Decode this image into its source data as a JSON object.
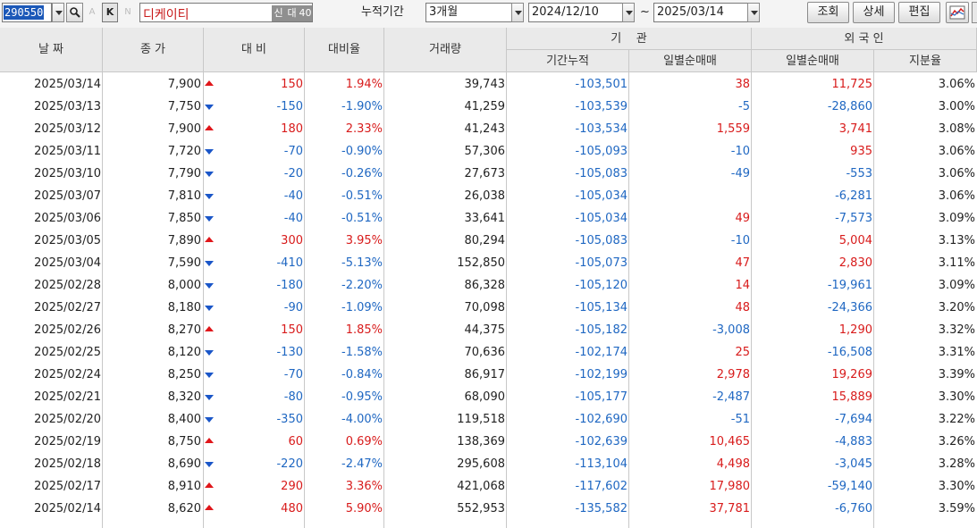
{
  "toolbar": {
    "code": "290550",
    "k_label": "K",
    "a_label": "A",
    "n_label": "N",
    "stock_name": "디케이티",
    "tag_new": "신",
    "tag_large": "대",
    "tag_40": "40",
    "period_label": "누적기간",
    "period_value": "3개월",
    "date_from": "2024/12/10",
    "date_sep": "~",
    "date_to": "2025/03/14",
    "btn_query": "조회",
    "btn_detail": "상세",
    "btn_edit": "편집"
  },
  "headers": {
    "date": "날 짜",
    "close": "종 가",
    "change": "대 비",
    "change_rate": "대비율",
    "volume": "거래량",
    "institution": "기    관",
    "inst_cum": "기간누적",
    "inst_daily": "일별순매매",
    "foreign": "외 국 인",
    "foreign_daily": "일별순매매",
    "foreign_ratio": "지분율"
  },
  "colors": {
    "up": "#d81b1b",
    "down": "#1f67c2",
    "header_bg": "#eaeaea"
  },
  "rows": [
    {
      "date": "2025/03/14",
      "close": "7,900",
      "dir": "up",
      "change": "150",
      "rate": "1.94%",
      "volume": "39,743",
      "inst_cum": "-103,501",
      "inst_daily": "38",
      "foreign_daily": "11,725",
      "foreign_ratio": "3.06%"
    },
    {
      "date": "2025/03/13",
      "close": "7,750",
      "dir": "down",
      "change": "-150",
      "rate": "-1.90%",
      "volume": "41,259",
      "inst_cum": "-103,539",
      "inst_daily": "-5",
      "foreign_daily": "-28,860",
      "foreign_ratio": "3.00%"
    },
    {
      "date": "2025/03/12",
      "close": "7,900",
      "dir": "up",
      "change": "180",
      "rate": "2.33%",
      "volume": "41,243",
      "inst_cum": "-103,534",
      "inst_daily": "1,559",
      "foreign_daily": "3,741",
      "foreign_ratio": "3.08%"
    },
    {
      "date": "2025/03/11",
      "close": "7,720",
      "dir": "down",
      "change": "-70",
      "rate": "-0.90%",
      "volume": "57,306",
      "inst_cum": "-105,093",
      "inst_daily": "-10",
      "foreign_daily": "935",
      "foreign_ratio": "3.06%"
    },
    {
      "date": "2025/03/10",
      "close": "7,790",
      "dir": "down",
      "change": "-20",
      "rate": "-0.26%",
      "volume": "27,673",
      "inst_cum": "-105,083",
      "inst_daily": "-49",
      "foreign_daily": "-553",
      "foreign_ratio": "3.06%"
    },
    {
      "date": "2025/03/07",
      "close": "7,810",
      "dir": "down",
      "change": "-40",
      "rate": "-0.51%",
      "volume": "26,038",
      "inst_cum": "-105,034",
      "inst_daily": "",
      "foreign_daily": "-6,281",
      "foreign_ratio": "3.06%"
    },
    {
      "date": "2025/03/06",
      "close": "7,850",
      "dir": "down",
      "change": "-40",
      "rate": "-0.51%",
      "volume": "33,641",
      "inst_cum": "-105,034",
      "inst_daily": "49",
      "foreign_daily": "-7,573",
      "foreign_ratio": "3.09%"
    },
    {
      "date": "2025/03/05",
      "close": "7,890",
      "dir": "up",
      "change": "300",
      "rate": "3.95%",
      "volume": "80,294",
      "inst_cum": "-105,083",
      "inst_daily": "-10",
      "foreign_daily": "5,004",
      "foreign_ratio": "3.13%"
    },
    {
      "date": "2025/03/04",
      "close": "7,590",
      "dir": "down",
      "change": "-410",
      "rate": "-5.13%",
      "volume": "152,850",
      "inst_cum": "-105,073",
      "inst_daily": "47",
      "foreign_daily": "2,830",
      "foreign_ratio": "3.11%"
    },
    {
      "date": "2025/02/28",
      "close": "8,000",
      "dir": "down",
      "change": "-180",
      "rate": "-2.20%",
      "volume": "86,328",
      "inst_cum": "-105,120",
      "inst_daily": "14",
      "foreign_daily": "-19,961",
      "foreign_ratio": "3.09%"
    },
    {
      "date": "2025/02/27",
      "close": "8,180",
      "dir": "down",
      "change": "-90",
      "rate": "-1.09%",
      "volume": "70,098",
      "inst_cum": "-105,134",
      "inst_daily": "48",
      "foreign_daily": "-24,366",
      "foreign_ratio": "3.20%"
    },
    {
      "date": "2025/02/26",
      "close": "8,270",
      "dir": "up",
      "change": "150",
      "rate": "1.85%",
      "volume": "44,375",
      "inst_cum": "-105,182",
      "inst_daily": "-3,008",
      "foreign_daily": "1,290",
      "foreign_ratio": "3.32%"
    },
    {
      "date": "2025/02/25",
      "close": "8,120",
      "dir": "down",
      "change": "-130",
      "rate": "-1.58%",
      "volume": "70,636",
      "inst_cum": "-102,174",
      "inst_daily": "25",
      "foreign_daily": "-16,508",
      "foreign_ratio": "3.31%"
    },
    {
      "date": "2025/02/24",
      "close": "8,250",
      "dir": "down",
      "change": "-70",
      "rate": "-0.84%",
      "volume": "86,917",
      "inst_cum": "-102,199",
      "inst_daily": "2,978",
      "foreign_daily": "19,269",
      "foreign_ratio": "3.39%"
    },
    {
      "date": "2025/02/21",
      "close": "8,320",
      "dir": "down",
      "change": "-80",
      "rate": "-0.95%",
      "volume": "68,090",
      "inst_cum": "-105,177",
      "inst_daily": "-2,487",
      "foreign_daily": "15,889",
      "foreign_ratio": "3.30%"
    },
    {
      "date": "2025/02/20",
      "close": "8,400",
      "dir": "down",
      "change": "-350",
      "rate": "-4.00%",
      "volume": "119,518",
      "inst_cum": "-102,690",
      "inst_daily": "-51",
      "foreign_daily": "-7,694",
      "foreign_ratio": "3.22%"
    },
    {
      "date": "2025/02/19",
      "close": "8,750",
      "dir": "up",
      "change": "60",
      "rate": "0.69%",
      "volume": "138,369",
      "inst_cum": "-102,639",
      "inst_daily": "10,465",
      "foreign_daily": "-4,883",
      "foreign_ratio": "3.26%"
    },
    {
      "date": "2025/02/18",
      "close": "8,690",
      "dir": "down",
      "change": "-220",
      "rate": "-2.47%",
      "volume": "295,608",
      "inst_cum": "-113,104",
      "inst_daily": "4,498",
      "foreign_daily": "-3,045",
      "foreign_ratio": "3.28%"
    },
    {
      "date": "2025/02/17",
      "close": "8,910",
      "dir": "up",
      "change": "290",
      "rate": "3.36%",
      "volume": "421,068",
      "inst_cum": "-117,602",
      "inst_daily": "17,980",
      "foreign_daily": "-59,140",
      "foreign_ratio": "3.30%"
    },
    {
      "date": "2025/02/14",
      "close": "8,620",
      "dir": "up",
      "change": "480",
      "rate": "5.90%",
      "volume": "552,953",
      "inst_cum": "-135,582",
      "inst_daily": "37,781",
      "foreign_daily": "-6,760",
      "foreign_ratio": "3.59%"
    }
  ]
}
